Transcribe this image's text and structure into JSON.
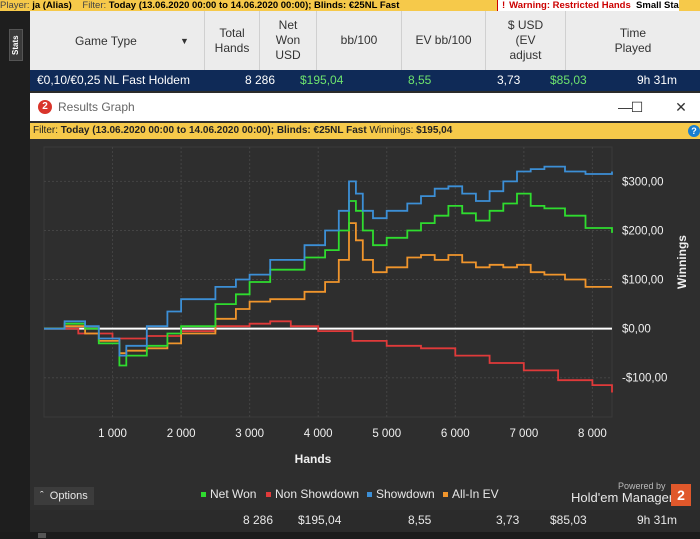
{
  "top_bar": {
    "player_label": "Player:",
    "player": "ja (Alias)",
    "filter_label": "Filter:",
    "filter": "Today (13.06.2020 00:00 to 14.06.2020 00:00); Blinds: €25NL Fast",
    "warning": "Warning: Restricted Hands",
    "warning_tail": "Small Sta"
  },
  "side_tab": {
    "label": "Stats"
  },
  "table": {
    "columns": [
      "Game Type",
      "Total\nHands",
      "Net\nWon\nUSD",
      "bb/100",
      "EV bb/100",
      "$ USD\n(EV\nadjust",
      "Time\nPlayed"
    ],
    "row": {
      "game_type": "€0,10/€0,25 NL Fast Holdem",
      "total_hands": "8 286",
      "net_won": "$195,04",
      "bb100": "8,55",
      "ev_bb100": "3,73",
      "ev_adjusted": "$85,03",
      "time_played": "9h 31m"
    },
    "footer": {
      "total_hands": "8 286",
      "net_won": "$195,04",
      "bb100": "8,55",
      "ev_bb100": "3,73",
      "ev_adjusted": "$85,03",
      "time_played": "9h 31m"
    }
  },
  "window": {
    "app_icon": "2",
    "title": "Results Graph",
    "filter_label": "Filter:",
    "filter": "Today (13.06.2020 00:00 to 14.06.2020 00:00); Blinds: €25NL Fast",
    "winnings_label": "Winnings:",
    "winnings": "$195,04"
  },
  "bottom": {
    "options_label": "Options",
    "powered_by": "Powered by",
    "brand": "Hold'em Manager",
    "brand_logo": "2"
  },
  "icons": {
    "warning": "warning-icon",
    "minimize": "minimize-icon",
    "maximize": "maximize-icon",
    "close": "close-icon",
    "help": "help-icon",
    "dropdown": "chevron-down-icon",
    "options": "chevron-up-icon"
  },
  "chart_data": {
    "type": "line",
    "xlabel": "Hands",
    "ylabel": "Winnings",
    "xlim": [
      0,
      8286
    ],
    "ylim": [
      -180,
      370
    ],
    "x_ticks": [
      "1 000",
      "2 000",
      "3 000",
      "4 000",
      "5 000",
      "6 000",
      "7 000",
      "8 000"
    ],
    "x_tick_values": [
      1000,
      2000,
      3000,
      4000,
      5000,
      6000,
      7000,
      8000
    ],
    "y_ticks": [
      "$300,00",
      "$200,00",
      "$100,00",
      "$0,00",
      "-$100,00"
    ],
    "y_tick_values": [
      300,
      200,
      100,
      0,
      -100
    ],
    "legend_position": "bottom",
    "background": "#2e2e2e",
    "series": [
      {
        "name": "Net Won",
        "color": "#2fdc2f",
        "x": [
          0,
          300,
          600,
          800,
          1100,
          1200,
          1500,
          1800,
          2000,
          2500,
          2800,
          3000,
          3300,
          3800,
          4100,
          4300,
          4450,
          4550,
          4650,
          4800,
          5000,
          5300,
          5500,
          5700,
          5900,
          6100,
          6300,
          6500,
          6700,
          6900,
          7100,
          7300,
          7600,
          7900,
          8286
        ],
        "y": [
          0,
          10,
          0,
          -30,
          -75,
          -55,
          -35,
          -10,
          5,
          50,
          70,
          95,
          120,
          145,
          160,
          200,
          260,
          240,
          200,
          170,
          185,
          200,
          215,
          230,
          250,
          235,
          220,
          240,
          255,
          275,
          250,
          245,
          230,
          205,
          195
        ]
      },
      {
        "name": "Non Showdown",
        "color": "#e03a3a",
        "x": [
          0,
          500,
          1000,
          1500,
          2000,
          2500,
          3000,
          3300,
          3600,
          4000,
          4500,
          5000,
          5500,
          6000,
          6500,
          7000,
          7500,
          8000,
          8286
        ],
        "y": [
          0,
          -10,
          -20,
          -15,
          -5,
          5,
          10,
          15,
          5,
          -5,
          -25,
          -35,
          -40,
          -55,
          -70,
          -85,
          -105,
          -115,
          -130
        ]
      },
      {
        "name": "Showdown",
        "color": "#3c8fd6",
        "x": [
          0,
          300,
          600,
          800,
          1100,
          1200,
          1500,
          1800,
          2000,
          2500,
          2800,
          3000,
          3300,
          3800,
          4100,
          4300,
          4450,
          4550,
          4650,
          4800,
          5000,
          5300,
          5500,
          5700,
          5900,
          6100,
          6300,
          6500,
          6700,
          6900,
          7100,
          7300,
          7600,
          7900,
          8286
        ],
        "y": [
          0,
          15,
          5,
          -20,
          -55,
          -35,
          5,
          35,
          60,
          85,
          100,
          110,
          140,
          170,
          200,
          240,
          300,
          275,
          240,
          225,
          240,
          255,
          270,
          285,
          290,
          275,
          260,
          280,
          300,
          320,
          325,
          330,
          320,
          315,
          320
        ]
      },
      {
        "name": "All-In EV",
        "color": "#f0952c",
        "x": [
          0,
          300,
          600,
          800,
          1100,
          1200,
          1500,
          1800,
          2000,
          2500,
          2800,
          3000,
          3300,
          3800,
          4100,
          4300,
          4450,
          4550,
          4650,
          4800,
          5000,
          5300,
          5500,
          5700,
          5900,
          6100,
          6300,
          6500,
          6700,
          6900,
          7100,
          7300,
          7600,
          7900,
          8286
        ],
        "y": [
          0,
          5,
          -10,
          -25,
          -50,
          -45,
          -40,
          -30,
          -10,
          20,
          40,
          55,
          60,
          75,
          95,
          140,
          215,
          180,
          140,
          115,
          125,
          145,
          150,
          140,
          150,
          135,
          125,
          130,
          125,
          130,
          115,
          110,
          100,
          85,
          85
        ]
      }
    ]
  }
}
